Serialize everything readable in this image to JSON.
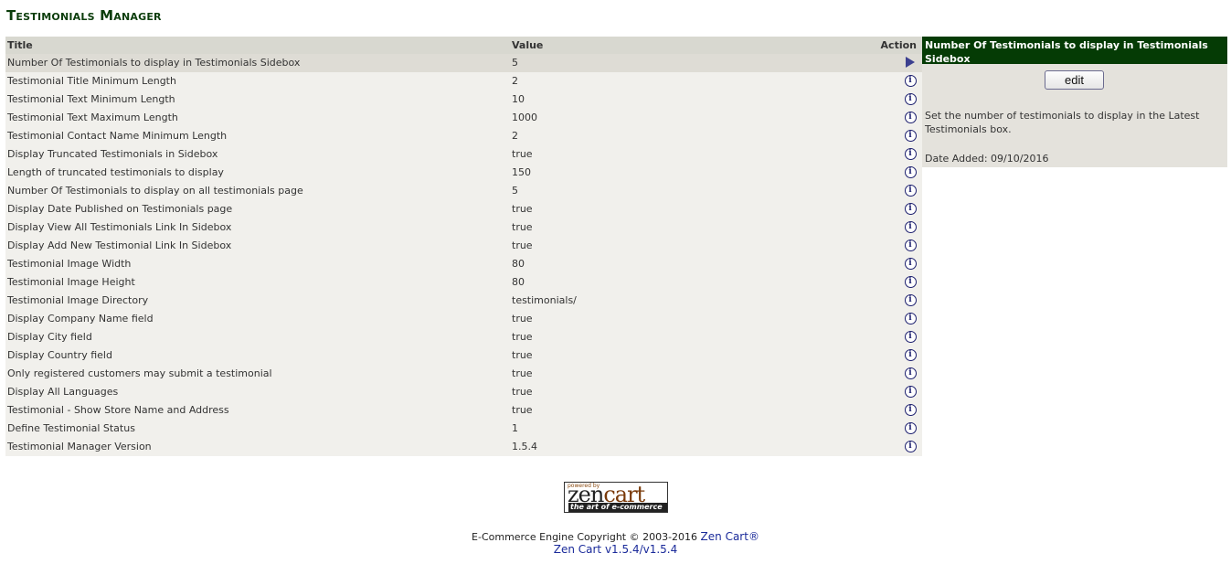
{
  "page": {
    "title": "Testimonials Manager"
  },
  "table": {
    "headers": {
      "title": "Title",
      "value": "Value",
      "action": "Action"
    },
    "rows": [
      {
        "title": "Number Of Testimonials to display in Testimonials Sidebox",
        "value": "5",
        "action": "arrow-icon",
        "selected": true
      },
      {
        "title": "Testimonial Title Minimum Length",
        "value": "2",
        "action": "info-icon"
      },
      {
        "title": "Testimonial Text Minimum Length",
        "value": "10",
        "action": "info-icon"
      },
      {
        "title": "Testimonial Text Maximum Length",
        "value": "1000",
        "action": "info-icon"
      },
      {
        "title": "Testimonial Contact Name Minimum Length",
        "value": "2",
        "action": "info-icon"
      },
      {
        "title": "Display Truncated Testimonials in Sidebox",
        "value": "true",
        "action": "info-icon"
      },
      {
        "title": "Length of truncated testimonials to display",
        "value": "150",
        "action": "info-icon"
      },
      {
        "title": "Number Of Testimonials to display on all testimonials page",
        "value": "5",
        "action": "info-icon"
      },
      {
        "title": "Display Date Published on Testimonials page",
        "value": "true",
        "action": "info-icon"
      },
      {
        "title": "Display View All Testimonials Link In Sidebox",
        "value": "true",
        "action": "info-icon"
      },
      {
        "title": "Display Add New Testimonial Link In Sidebox",
        "value": "true",
        "action": "info-icon"
      },
      {
        "title": "Testimonial Image Width",
        "value": "80",
        "action": "info-icon"
      },
      {
        "title": "Testimonial Image Height",
        "value": "80",
        "action": "info-icon"
      },
      {
        "title": "Testimonial Image Directory",
        "value": "testimonials/",
        "action": "info-icon"
      },
      {
        "title": "Display Company Name field",
        "value": "true",
        "action": "info-icon"
      },
      {
        "title": "Display City field",
        "value": "true",
        "action": "info-icon"
      },
      {
        "title": "Display Country field",
        "value": "true",
        "action": "info-icon"
      },
      {
        "title": "Only registered customers may submit a testimonial",
        "value": "true",
        "action": "info-icon"
      },
      {
        "title": "Display All Languages",
        "value": "true",
        "action": "info-icon"
      },
      {
        "title": "Testimonial - Show Store Name and Address",
        "value": "true",
        "action": "info-icon"
      },
      {
        "title": "Define Testimonial Status",
        "value": "1",
        "action": "info-icon"
      },
      {
        "title": "Testimonial Manager Version",
        "value": "1.5.4",
        "action": "info-icon"
      }
    ]
  },
  "panel": {
    "heading": "Number Of Testimonials to display in Testimonials Sidebox",
    "edit_label": "edit",
    "description": "Set the number of testimonials to display in the Latest Testimonials box.",
    "date_added": "Date Added: 09/10/2016"
  },
  "footer": {
    "logo": {
      "powered_by": "powered by",
      "word_zen": "zen",
      "word_cart": "cart",
      "tagline": "the art of e-commerce"
    },
    "copyright": "E-Commerce Engine Copyright © 2003-2016 ",
    "copyright_link": "Zen Cart®",
    "version_link": "Zen Cart v1.5.4/v1.5.4"
  },
  "colors": {
    "heading_green": "#053b05",
    "table_bg": "#f1f0ec",
    "header_bg": "#d8d8d0",
    "link_blue": "#1a2a9a"
  }
}
